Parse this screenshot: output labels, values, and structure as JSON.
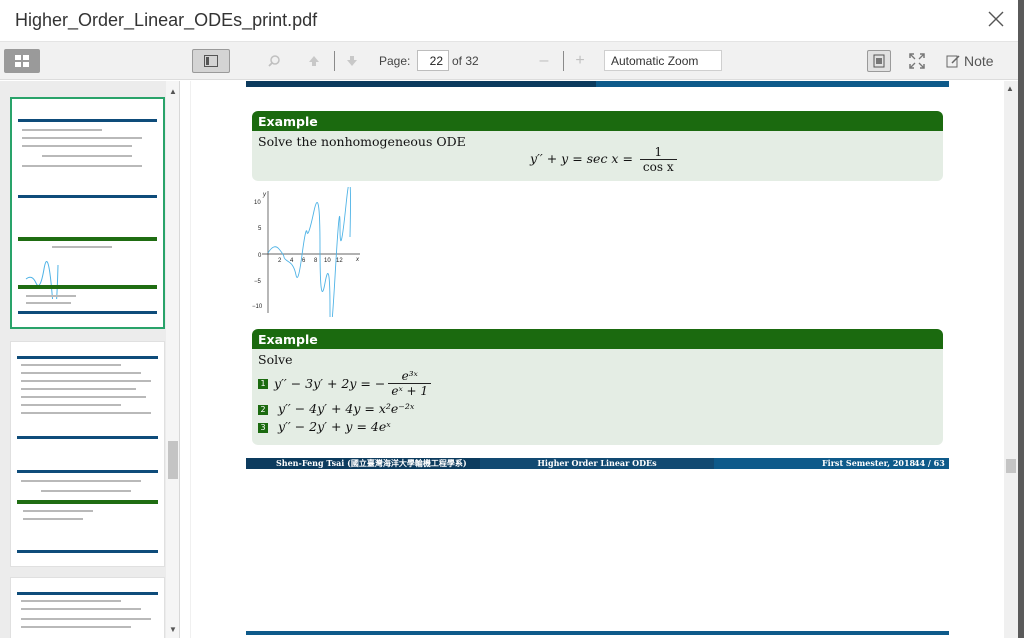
{
  "window": {
    "title": "Higher_Order_Linear_ODEs_print.pdf",
    "close_icon": "close-icon"
  },
  "toolbar": {
    "page_label": "Page:",
    "page_value": "22",
    "page_of": "of 32",
    "zoom_out_label": "–",
    "zoom_in_label": "+",
    "zoom_value": "Automatic Zoom",
    "note_label": "Note",
    "icons": [
      "thumbnails-grid-icon",
      "sidebar-toggle-icon",
      "search-icon",
      "arrow-up-icon",
      "arrow-down-icon",
      "presentation-icon",
      "fullscreen-icon",
      "note-edit-icon"
    ]
  },
  "document": {
    "example1": {
      "header": "Example",
      "text": "Solve the nonhomogeneous ODE",
      "equation_lhs": "y′′ + y = sec x =",
      "equation_num": "1",
      "equation_den": "cos x"
    },
    "plot": {
      "y_ticks": [
        "10",
        "5",
        "0",
        "−5",
        "−10"
      ],
      "x_ticks": [
        "2",
        "4",
        "6",
        "8",
        "10",
        "12"
      ],
      "x_label": "x",
      "y_label": "y"
    },
    "example2": {
      "header": "Example",
      "text": "Solve",
      "items": [
        {
          "num": "1",
          "lhs": "y′′ − 3y′ + 2y = −",
          "num_frac": "e³ˣ",
          "den_frac": "eˣ + 1"
        },
        {
          "num": "2",
          "eq": "y′′ − 4y′ + 4y = x²e⁻²ˣ"
        },
        {
          "num": "3",
          "eq": "y′′ − 2y′ + y = 4eˣ"
        }
      ]
    },
    "footer": {
      "author": "Shen-Feng Tsai  (國立臺灣海洋大學輪機工程學系)",
      "course": "Higher Order Linear ODEs",
      "semester": "First Semester, 2018",
      "slide": "44 / 63"
    }
  },
  "colors": {
    "accent_green": "#1b6a0f",
    "block_bg": "#e4ede4",
    "footer_blue": "#0e5a8a",
    "active_thumb_border": "#29a36a"
  }
}
